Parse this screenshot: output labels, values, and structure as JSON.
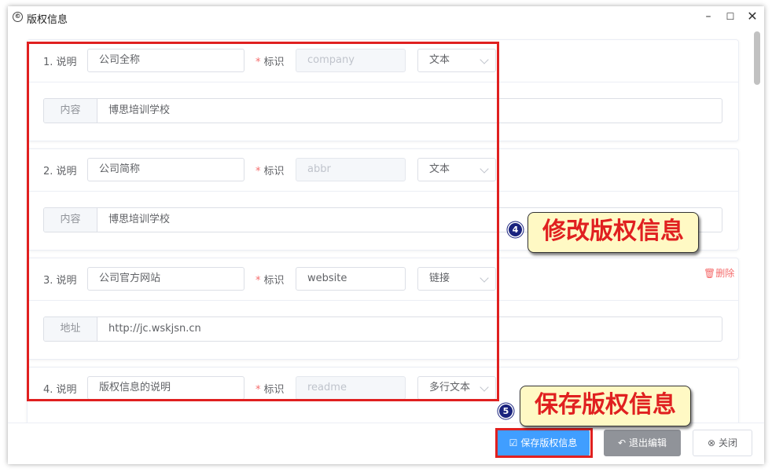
{
  "window": {
    "title": "版权信息",
    "minimize_icon": "minimize-icon",
    "maximize_icon": "maximize-icon",
    "close_icon": "close-icon"
  },
  "form": {
    "desc_label_suffix": "说明",
    "key_label": "标识",
    "items": [
      {
        "index": "1. 说明",
        "desc": "公司全称",
        "key": "company",
        "key_disabled": true,
        "type": "文本",
        "content_label": "内容",
        "content": "博思培训学校",
        "deletable": false
      },
      {
        "index": "2. 说明",
        "desc": "公司简称",
        "key": "abbr",
        "key_disabled": true,
        "type": "文本",
        "content_label": "内容",
        "content": "博思培训学校",
        "deletable": false
      },
      {
        "index": "3. 说明",
        "desc": "公司官方网站",
        "key": "website",
        "key_disabled": false,
        "type": "链接",
        "content_label": "地址",
        "content": "http://jc.wskjsn.cn",
        "deletable": true
      },
      {
        "index": "4. 说明",
        "desc": "版权信息的说明",
        "key": "readme",
        "key_disabled": true,
        "type": "多行文本",
        "content_label": "",
        "content": "",
        "deletable": false
      }
    ],
    "delete_label": "删除"
  },
  "footer": {
    "save_label": "保存版权信息",
    "exit_label": "退出编辑",
    "close_label": "关闭"
  },
  "annotations": {
    "callout_modify": {
      "badge": "4",
      "text": "修改版权信息"
    },
    "callout_save": {
      "badge": "5",
      "text": "保存版权信息"
    }
  },
  "colors": {
    "primary": "#409eff",
    "danger": "#f56c6c",
    "highlight": "#e02020",
    "callout_bg": "#fff9c4"
  }
}
